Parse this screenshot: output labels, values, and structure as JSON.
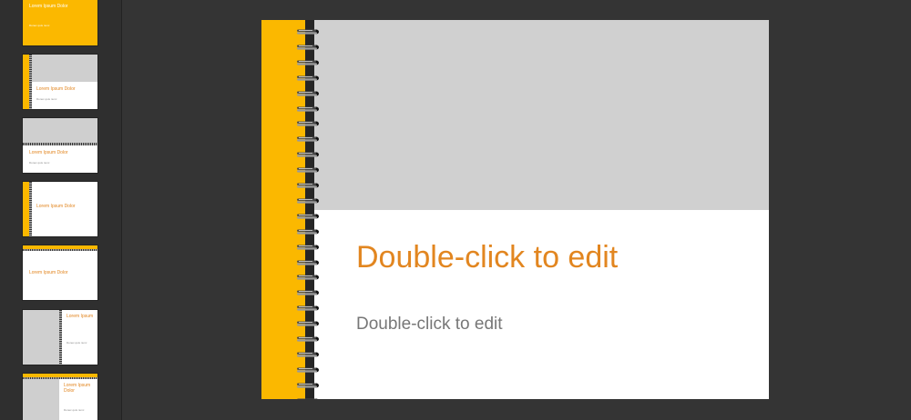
{
  "thumbnails": [
    {
      "title": "Lorem Ipsum Dolor",
      "subtitle": "Donec quis nunc"
    },
    {
      "title": "Lorem Ipsum Dolor",
      "subtitle": "Donec quis nunc"
    },
    {
      "title": "Lorem Ipsum Dolor",
      "subtitle": "Donec quis nunc"
    },
    {
      "title": "Lorem Ipsum Dolor"
    },
    {
      "title": "Lorem Ipsum Dolor"
    },
    {
      "title": "Lorem Ipsum",
      "subtitle": "Donec quis nunc"
    },
    {
      "title": "Lorem Ipsum Dolor",
      "subtitle": "Donec quis nunc"
    }
  ],
  "slide": {
    "title_placeholder": "Double-click to edit",
    "body_placeholder": "Double-click to edit"
  },
  "colors": {
    "accent": "#e28620",
    "binding_yellow": "#fbb800",
    "photo_gray": "#d0d0d0",
    "background": "#343434"
  }
}
